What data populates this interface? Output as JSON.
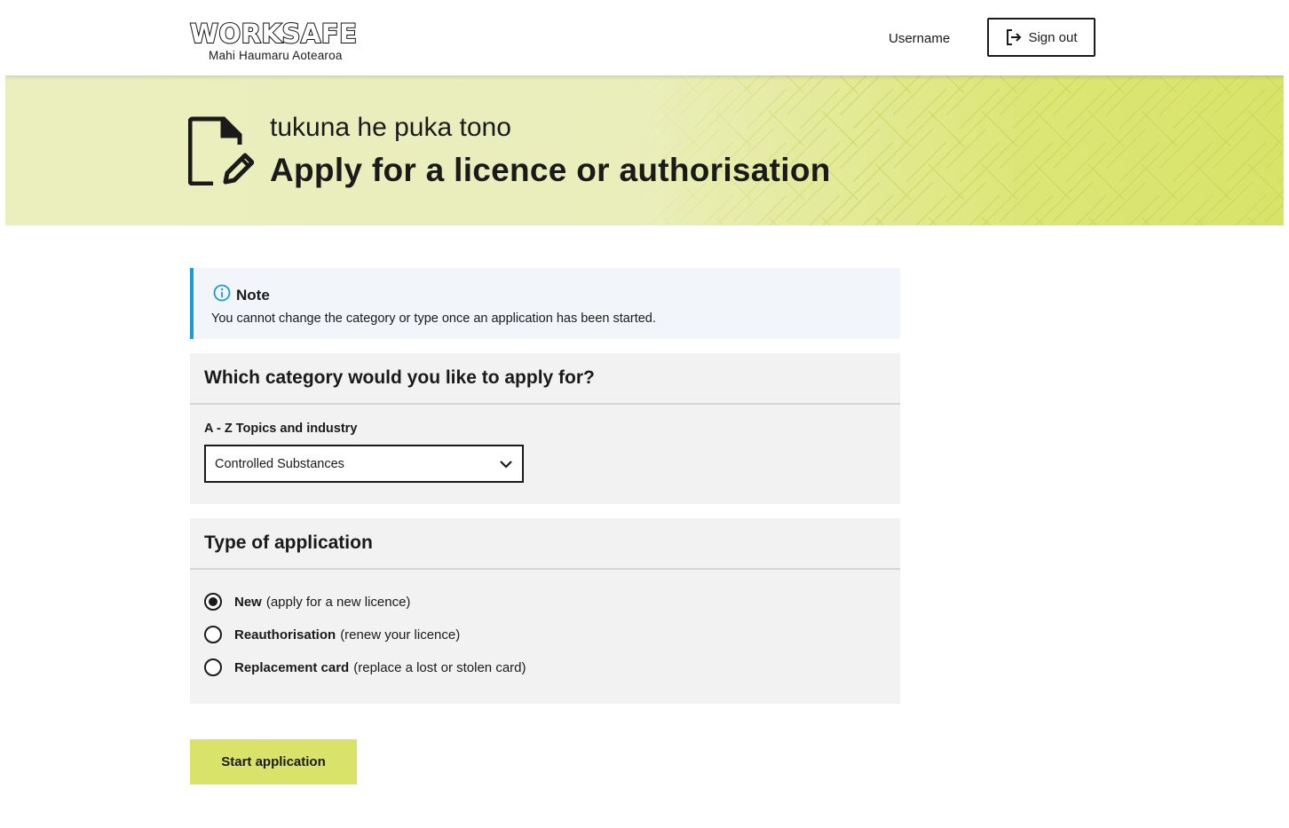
{
  "header": {
    "logo_text": "WORKSAFE",
    "logo_subtitle": "Mahi Haumaru Aotearoa",
    "username": "Username",
    "signout_label": "Sign out"
  },
  "banner": {
    "subtitle": "tukuna he puka tono",
    "title": "Apply for a licence or authorisation"
  },
  "note": {
    "title": "Note",
    "text": "You cannot change the category or type once an application has been started."
  },
  "category": {
    "heading": "Which category would you like to apply for?",
    "field_label": "A - Z Topics and industry",
    "selected_value": "Controlled Substances"
  },
  "application_type": {
    "heading": "Type of application",
    "options": [
      {
        "label": "New",
        "hint": "(apply for a new licence)",
        "checked": true
      },
      {
        "label": "Reauthorisation",
        "hint": "(renew your licence)",
        "checked": false
      },
      {
        "label": "Replacement card",
        "hint": "(replace a lost or stolen card)",
        "checked": false
      }
    ]
  },
  "actions": {
    "start_label": "Start application"
  },
  "colors": {
    "accent_lime": "#d9e36a",
    "note_border": "#1a9bd7",
    "note_background": "#f2f6fb",
    "panel_background": "#f2f2f2"
  },
  "icons": {
    "signout": "sign-out-icon",
    "banner": "document-edit-icon",
    "note": "info-icon",
    "select": "chevron-down-icon"
  }
}
